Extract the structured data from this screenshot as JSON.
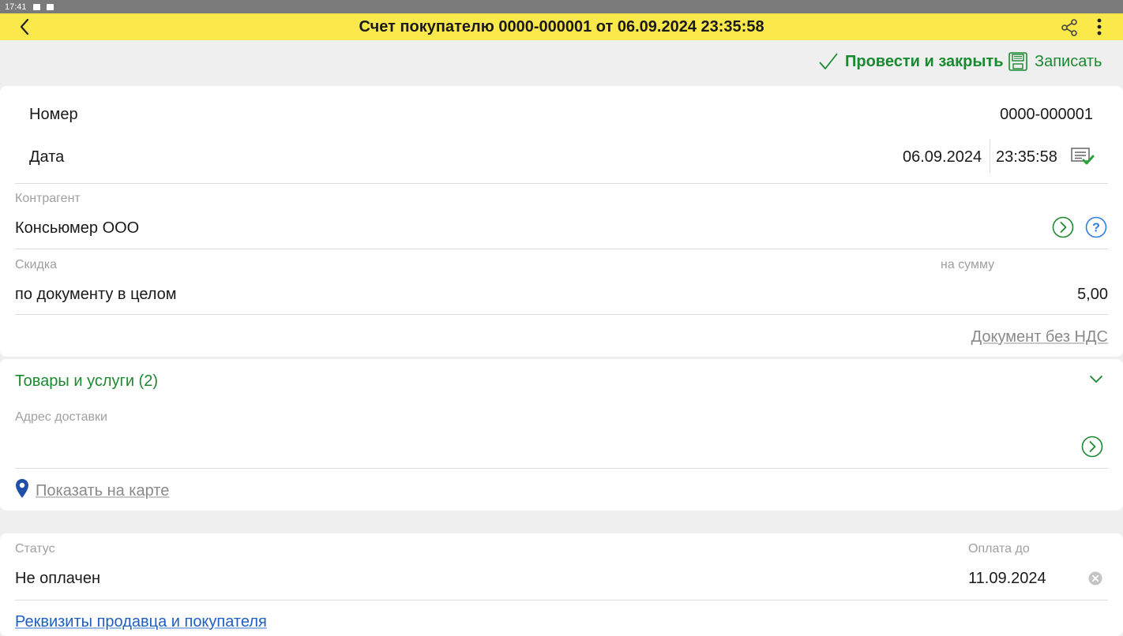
{
  "statusbar": {
    "time": "17:41"
  },
  "header": {
    "title": "Счет покупателю 0000-000001 от 06.09.2024 23:35:58"
  },
  "actions": {
    "post_close": "Провести и закрыть",
    "save": "Записать"
  },
  "doc": {
    "number_label": "Номер",
    "number_value": "0000-000001",
    "date_label": "Дата",
    "date_value": "06.09.2024",
    "time_value": "23:35:58"
  },
  "counterparty": {
    "caption": "Контрагент",
    "value": "Консьюмер ООО"
  },
  "discount": {
    "caption": "Скидка",
    "sum_caption": "на сумму",
    "value": "по документу в целом",
    "amount": "5,00",
    "vat_link": "Документ без НДС"
  },
  "goods": {
    "label": "Товары и услуги (2)"
  },
  "delivery": {
    "caption": "Адрес доставки",
    "value": "",
    "map_link": "Показать на карте"
  },
  "status": {
    "caption": "Статус",
    "value": "Не оплачен",
    "pay_caption": "Оплата до",
    "pay_value": "11.09.2024"
  },
  "requisites": {
    "link": "Реквизиты продавца и покупателя"
  },
  "colors": {
    "header_bg": "#fbe94b",
    "accent_green": "#1a8a30",
    "link_blue": "#1f5fbf",
    "help_blue": "#2f7de1"
  },
  "icons": [
    "back-arrow-icon",
    "share-icon",
    "more-vert-icon",
    "checkmark-icon",
    "floppy-disk-icon",
    "document-check-icon",
    "open-circle-arrow-icon",
    "help-circle-icon",
    "chevron-down-icon",
    "map-pin-icon",
    "clear-circle-icon"
  ]
}
